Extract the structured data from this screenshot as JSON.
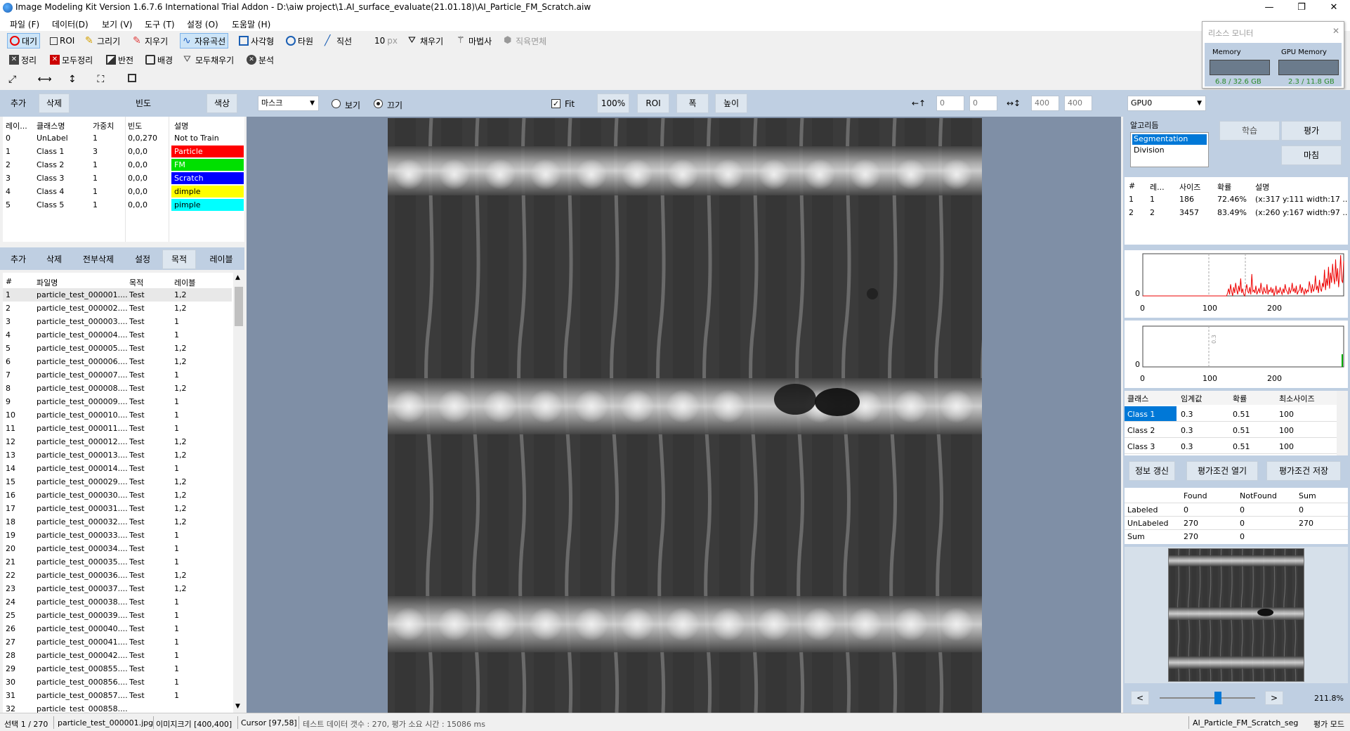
{
  "window": {
    "title": "Image Modeling Kit   Version 1.6.7.6  International Trial Addon    - D:\\aiw project\\1.AI_surface_evaluate(21.01.18)\\AI_Particle_FM_Scratch.aiw",
    "min": "—",
    "max": "❐",
    "close": "✕"
  },
  "menu": [
    "파일 (F)",
    "데이터(D)",
    "보기 (V)",
    "도구 (T)",
    "설정 (O)",
    "도움말 (H)"
  ],
  "toolbar1": {
    "idle": "대기",
    "roi": "ROI",
    "draw": "그리기",
    "erase": "지우기",
    "freecurve": "자유곡선",
    "rect": "사각형",
    "ellipse": "타원",
    "line": "직선",
    "size_value": "10",
    "size_unit": "px",
    "fill": "채우기",
    "magic": "마법사",
    "rectfill": "직육면체"
  },
  "toolbar2": {
    "clean": "정리",
    "clean_all": "모두정리",
    "invert": "반전",
    "background": "배경",
    "fill_all": "모두채우기",
    "analyze": "분석"
  },
  "resource_monitor": {
    "title": "리소스 모니터",
    "memory_label": "Memory",
    "memory_value": "6.8 / 32.6 GB",
    "gpu_label": "GPU Memory",
    "gpu_value": "2.3 / 11.8 GB"
  },
  "class_panel": {
    "buttons": {
      "add": "추가",
      "delete": "삭제",
      "freq": "빈도",
      "color": "색상"
    },
    "headers": [
      "레이...",
      "클래스명",
      "가중치",
      "빈도",
      "설명"
    ],
    "rows": [
      {
        "id": "0",
        "name": "UnLabel",
        "weight": "1",
        "freq": "0,0,270",
        "desc": "Not to Train",
        "color": "#ffffff",
        "fg": "#000000"
      },
      {
        "id": "1",
        "name": "Class 1",
        "weight": "3",
        "freq": "0,0,0",
        "desc": "Particle",
        "color": "#ff0000",
        "fg": "#ffffff"
      },
      {
        "id": "2",
        "name": "Class 2",
        "weight": "1",
        "freq": "0,0,0",
        "desc": "FM",
        "color": "#00e000",
        "fg": "#ffffff"
      },
      {
        "id": "3",
        "name": "Class 3",
        "weight": "1",
        "freq": "0,0,0",
        "desc": "Scratch",
        "color": "#0000ff",
        "fg": "#ffffff"
      },
      {
        "id": "4",
        "name": "Class 4",
        "weight": "1",
        "freq": "0,0,0",
        "desc": "dimple",
        "color": "#ffff00",
        "fg": "#000000"
      },
      {
        "id": "5",
        "name": "Class 5",
        "weight": "1",
        "freq": "0,0,0",
        "desc": "pimple",
        "color": "#00ffff",
        "fg": "#000000"
      }
    ]
  },
  "file_panel": {
    "buttons": {
      "add": "추가",
      "delete": "삭제",
      "delete_all": "전부삭제",
      "settings": "설정",
      "purpose": "목적",
      "label": "레이블"
    },
    "headers": [
      "#",
      "파일명",
      "목적",
      "레이블"
    ],
    "rows": [
      [
        "1",
        "particle_test_000001....",
        "Test",
        "1,2"
      ],
      [
        "2",
        "particle_test_000002....",
        "Test",
        "1,2"
      ],
      [
        "3",
        "particle_test_000003....",
        "Test",
        "1"
      ],
      [
        "4",
        "particle_test_000004....",
        "Test",
        "1"
      ],
      [
        "5",
        "particle_test_000005....",
        "Test",
        "1,2"
      ],
      [
        "6",
        "particle_test_000006....",
        "Test",
        "1,2"
      ],
      [
        "7",
        "particle_test_000007....",
        "Test",
        "1"
      ],
      [
        "8",
        "particle_test_000008....",
        "Test",
        "1,2"
      ],
      [
        "9",
        "particle_test_000009....",
        "Test",
        "1"
      ],
      [
        "10",
        "particle_test_000010....",
        "Test",
        "1"
      ],
      [
        "11",
        "particle_test_000011....",
        "Test",
        "1"
      ],
      [
        "12",
        "particle_test_000012....",
        "Test",
        "1,2"
      ],
      [
        "13",
        "particle_test_000013....",
        "Test",
        "1,2"
      ],
      [
        "14",
        "particle_test_000014....",
        "Test",
        "1"
      ],
      [
        "15",
        "particle_test_000029....",
        "Test",
        "1,2"
      ],
      [
        "16",
        "particle_test_000030....",
        "Test",
        "1,2"
      ],
      [
        "17",
        "particle_test_000031....",
        "Test",
        "1,2"
      ],
      [
        "18",
        "particle_test_000032....",
        "Test",
        "1,2"
      ],
      [
        "19",
        "particle_test_000033....",
        "Test",
        "1"
      ],
      [
        "20",
        "particle_test_000034....",
        "Test",
        "1"
      ],
      [
        "21",
        "particle_test_000035....",
        "Test",
        "1"
      ],
      [
        "22",
        "particle_test_000036....",
        "Test",
        "1,2"
      ],
      [
        "23",
        "particle_test_000037....",
        "Test",
        "1,2"
      ],
      [
        "24",
        "particle_test_000038....",
        "Test",
        "1"
      ],
      [
        "25",
        "particle_test_000039....",
        "Test",
        "1"
      ],
      [
        "26",
        "particle_test_000040....",
        "Test",
        "1"
      ],
      [
        "27",
        "particle_test_000041....",
        "Test",
        "1"
      ],
      [
        "28",
        "particle_test_000042....",
        "Test",
        "1"
      ],
      [
        "29",
        "particle_test_000855....",
        "Test",
        "1"
      ],
      [
        "30",
        "particle_test_000856....",
        "Test",
        "1"
      ],
      [
        "31",
        "particle_test_000857....",
        "Test",
        "1"
      ],
      [
        "32",
        "particle_test_000858....",
        "",
        ""
      ]
    ]
  },
  "view_bar": {
    "mask_select": "마스크",
    "view": "보기",
    "off": "끄기",
    "fit": "Fit",
    "zoom100": "100%",
    "roi": "ROI",
    "width": "폭",
    "height": "높이",
    "pos_label": "←↑",
    "x": "0",
    "y": "0",
    "size_label": "↔↕",
    "w": "400",
    "h": "400"
  },
  "right_panel": {
    "gpu": "GPU0",
    "algo_label": "알고리듬",
    "algos": [
      "Segmentation",
      "Division"
    ],
    "btn_train": "학습",
    "btn_eval": "평가",
    "btn_finish": "마침",
    "result_headers": [
      "#",
      "레...",
      "사이즈",
      "확률",
      "설명"
    ],
    "results": [
      [
        "1",
        "1",
        "186",
        "72.46%",
        "(x:317 y:111 width:17 ..."
      ],
      [
        "2",
        "2",
        "3457",
        "83.49%",
        "(x:260 y:167 width:97 ..."
      ]
    ],
    "hist1_ticks": [
      "0",
      "100",
      "200"
    ],
    "hist1_y0": "0",
    "hist2_ticks": [
      "0",
      "100",
      "200"
    ],
    "hist2_y0": "0",
    "hist2_marker": "0.3",
    "thr_headers": [
      "클래스",
      "임계값",
      "확률",
      "최소사이즈"
    ],
    "thr_rows": [
      [
        "Class 1",
        "0.3",
        "0.51",
        "100"
      ],
      [
        "Class 2",
        "0.3",
        "0.51",
        "100"
      ],
      [
        "Class 3",
        "0.3",
        "0.51",
        "100"
      ]
    ],
    "btn_refresh": "정보 갱신",
    "btn_open": "평가조건 열기",
    "btn_save": "평가조건 저장",
    "stat_headers": [
      "",
      "Found",
      "NotFound",
      "Sum"
    ],
    "stat_rows": [
      [
        "Labeled",
        "0",
        "0",
        "0"
      ],
      [
        "UnLabeled",
        "270",
        "0",
        "270"
      ],
      [
        "Sum",
        "270",
        "0",
        ""
      ]
    ],
    "prev": "<",
    "next": ">",
    "zoom": "211.8%"
  },
  "hist1_values": [
    0,
    0,
    0,
    0,
    0,
    0,
    0,
    0,
    0,
    0,
    0,
    0,
    0,
    0,
    0,
    0,
    0,
    0,
    0,
    0,
    0,
    0,
    0,
    0,
    0,
    0,
    0,
    0,
    0,
    0,
    0,
    0,
    0,
    0,
    0,
    0,
    0,
    0,
    0,
    0,
    0,
    0,
    0,
    0,
    0,
    0,
    0,
    0,
    0,
    0,
    0,
    0,
    0,
    0,
    0,
    0,
    0,
    0,
    0,
    0,
    0,
    0,
    0,
    0,
    0,
    0,
    0,
    0,
    0,
    0,
    0,
    0,
    0,
    0,
    0,
    0,
    0,
    0,
    0,
    0,
    0,
    0,
    0,
    0,
    2,
    5,
    1,
    8,
    3,
    0,
    6,
    2,
    9,
    4,
    1,
    7,
    3,
    12,
    2,
    5,
    1,
    0,
    4,
    8,
    3,
    2,
    6,
    1,
    15,
    3,
    4,
    2,
    7,
    1,
    3,
    5,
    2,
    9,
    4,
    1,
    6,
    3,
    2,
    8,
    1,
    4,
    3,
    6,
    2,
    5,
    0,
    3,
    7,
    1,
    4,
    2,
    6,
    3,
    1,
    5,
    2,
    8,
    4,
    3,
    1,
    6,
    2,
    4,
    9,
    3,
    5,
    2,
    7,
    1,
    3,
    4,
    8,
    2,
    6,
    3,
    1,
    5,
    2,
    4,
    3,
    10,
    6,
    2,
    8,
    3,
    5,
    14,
    4,
    7,
    2,
    11,
    5,
    3,
    9,
    6,
    18,
    4,
    12,
    7,
    20,
    5,
    16,
    9,
    22,
    13,
    8,
    25,
    10,
    19,
    6,
    15,
    28,
    11,
    9,
    24
  ],
  "status": {
    "selection": "선택 1 / 270",
    "file": "particle_test_000001.jpg",
    "imgsize": "이미지크기 [400,400]",
    "cursor": "Cursor [97,58]",
    "info": "테스트 데이터 갯수 : 270,   평가 소요 시간 : 15086 ms",
    "project": "AI_Particle_FM_Scratch_seg",
    "mode": "평가 모드"
  }
}
